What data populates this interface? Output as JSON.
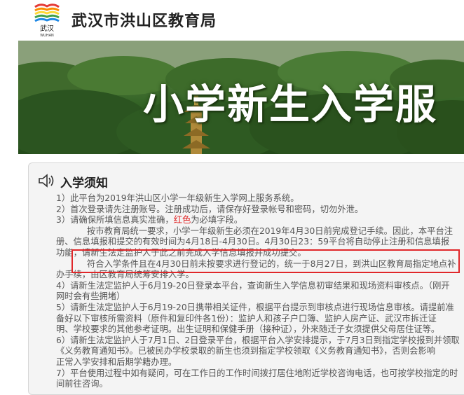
{
  "header": {
    "logo_text": "武汉",
    "logo_caption": "WUHAN",
    "title": "武汉市洪山区教育局"
  },
  "banner": {
    "title": "小学新生入学服"
  },
  "notice": {
    "title": "入学须知",
    "lines": [
      "1）此平台为2019年洪山区小学一年级新生入学网上服务系统。",
      "2）首次登录请先注册账号。注册成功后，请保存好登录帐号和密码，切勿外泄。",
      "3）请确保所填信息真实准确，",
      "按市教育局统一要求，小学一年级新生必须在2019年4月30日前完成登记手续。因此，本平台注",
      "册、信息填报和提交的有效时间为4月18日-4月30日。4月30日23：59平台将自动停止注册和信息填报",
      "功能，请新生法定监护人于此之前完成入学信息填报并成功提交。",
      "符合入学条件且在4月30日前未按要求进行登记的，统一于8月27日，到洪山区教育局指定地点补",
      "办手续，由区教育局统筹安排入学。",
      "4）请新生法定监护人于6月19-20日登录本平台，查询新生入学信息初审结果和现场资料审核点。（刚开",
      "网时会有些拥堵）",
      "5）请新生法定监护人于6月19-20日携带相关证件，根据平台提示到审核点进行现场信息审核。请提前准",
      "备好以下审核所需资料（原件和复印件各1份）：监护人和孩子户口簿、监护人房产证、武汉市拆迁证",
      "明、学校要求的其他参考证明。出生证明和保健手册（接种证），外来随迁子女须提供父母居住证等。",
      "6）请新生法定监护人于7月1日、2日登录平台，根据平台入学安排提示，于7月3日到指定学校报到并领取",
      "《义务教育通知书》。已被民办学校录取的新生也须到指定学校领取《义务教育通知书》，否则会影响",
      "正常入学安排和后期学籍办理。",
      "7）平台使用过程中如有疑问，可在工作日的工作时间拨打居住地附近学校咨询电话，也可按学校指定的时",
      "间前往咨询。"
    ],
    "red_word": "红色",
    "line3_suffix": "为必填字段。"
  },
  "colors": {
    "highlight": "#e0272a",
    "required": "#e01b1b"
  }
}
